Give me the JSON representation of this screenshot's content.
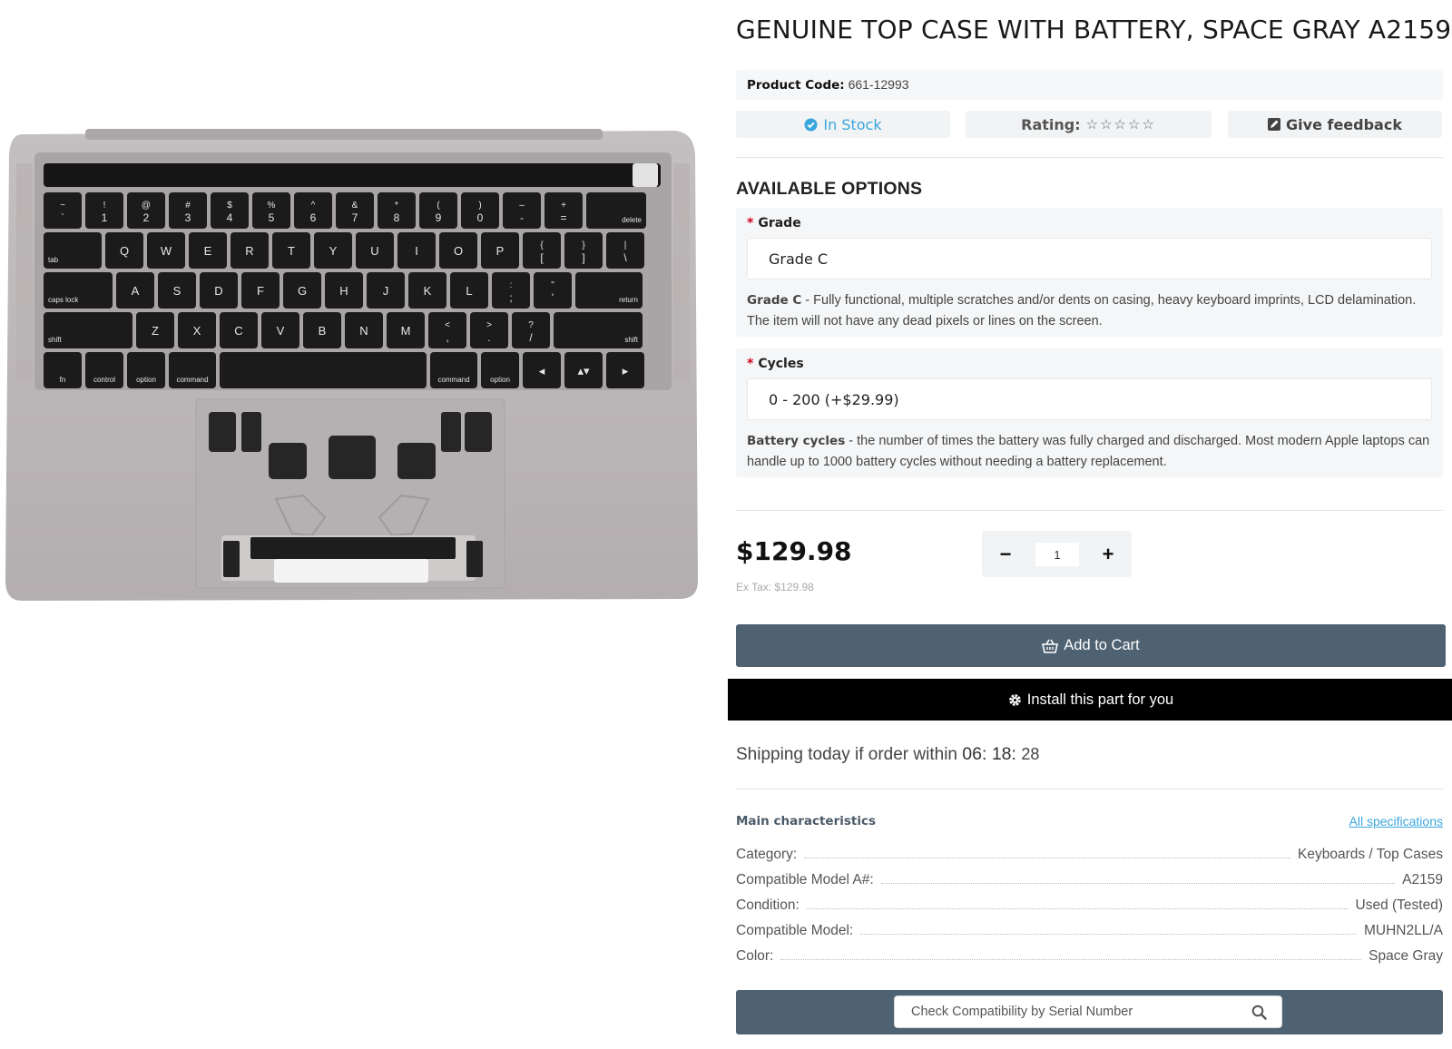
{
  "product": {
    "title": "GENUINE TOP CASE WITH BATTERY, SPACE GRAY A2159",
    "code_label": "Product Code:",
    "code_value": "661-12993",
    "stock": "In Stock",
    "rating_label": "Rating:",
    "rating_stars": "☆☆☆☆☆",
    "feedback": "Give feedback"
  },
  "options": {
    "heading": "AVAILABLE OPTIONS",
    "grade": {
      "required_mark": "*",
      "label": "Grade",
      "value": "Grade C",
      "desc_bold": "Grade C",
      "desc": " - Fully functional, multiple scratches and/or dents on casing, heavy keyboard imprints, LCD delamination. The item will not have any dead pixels or lines on the screen."
    },
    "cycles": {
      "required_mark": "*",
      "label": "Cycles",
      "value": "0 - 200 (+$29.99)",
      "desc_bold": "Battery cycles",
      "desc": " - the number of times the battery was fully charged and discharged. Most modern Apple laptops can handle up to 1000 battery cycles without needing a battery replacement."
    }
  },
  "purchase": {
    "price": "$129.98",
    "ex_tax": "Ex Tax: $129.98",
    "qty_minus": "−",
    "qty_plus": "+",
    "qty_value": "1",
    "add_to_cart": "Add to Cart",
    "install": "Install this part for you"
  },
  "shipping": {
    "text": "Shipping today if order within ",
    "hours": "06",
    "minutes": "18",
    "seconds": "28"
  },
  "characteristics": {
    "title": "Main characteristics",
    "all_link": "All specifications",
    "rows": [
      {
        "key": "Category:",
        "value": "Keyboards / Top Cases"
      },
      {
        "key": "Compatible Model A#:",
        "value": "A2159"
      },
      {
        "key": "Condition:",
        "value": "Used (Tested)"
      },
      {
        "key": "Compatible Model:",
        "value": "MUHN2LL/A"
      },
      {
        "key": "Color:",
        "value": "Space Gray"
      }
    ]
  },
  "serial": {
    "placeholder": "Check Compatibility by Serial Number"
  },
  "keyboard": {
    "row1": [
      [
        "~",
        "`"
      ],
      [
        "!",
        "1"
      ],
      [
        "@",
        "2"
      ],
      [
        "#",
        "3"
      ],
      [
        "$",
        "4"
      ],
      [
        "%",
        "5"
      ],
      [
        "^",
        "6"
      ],
      [
        "&",
        "7"
      ],
      [
        "*",
        "8"
      ],
      [
        "(",
        "9"
      ],
      [
        ")",
        "0"
      ],
      [
        "–",
        "-"
      ],
      [
        "+",
        "="
      ],
      [
        "",
        "delete"
      ]
    ],
    "row2": [
      "tab",
      "Q",
      "W",
      "E",
      "R",
      "T",
      "Y",
      "U",
      "I",
      "O",
      "P",
      "{ [",
      "} ]",
      "| \\"
    ],
    "row3": [
      "caps lock",
      "A",
      "S",
      "D",
      "F",
      "G",
      "H",
      "J",
      "K",
      "L",
      ": ;",
      "\" '",
      "return"
    ],
    "row4": [
      "shift",
      "Z",
      "X",
      "C",
      "V",
      "B",
      "N",
      "M",
      "< ,",
      "> .",
      "? /",
      "shift"
    ],
    "row5": [
      "fn",
      "control",
      "option",
      "command",
      "",
      "command",
      "option",
      "◂",
      "▴▾",
      "▸"
    ]
  },
  "colors": {
    "accent_blue": "#3aa6dd",
    "button_slate": "#4f6272",
    "install_black": "#000000",
    "required_red": "#d0021b",
    "case_gray": "#bdb8b9"
  }
}
